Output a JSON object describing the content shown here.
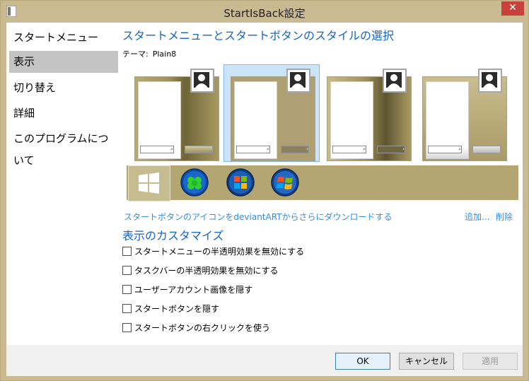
{
  "window": {
    "title": "StartIsBack設定",
    "close_label": "✕"
  },
  "sidebar": {
    "items": [
      {
        "label": "スタートメニュー"
      },
      {
        "label": "表示"
      },
      {
        "label": "切り替え"
      },
      {
        "label": "詳細"
      },
      {
        "label": "このプログラムについて"
      }
    ],
    "selected_index": 1
  },
  "main": {
    "heading": "スタートメニューとスタートボタンのスタイルの選択",
    "theme_label": "テーマ:",
    "theme_value": "Plain8",
    "styles": {
      "selected_index": 1,
      "search_glyph": "⌕",
      "arrow_glyph": "›"
    },
    "start_buttons": {
      "selected_index": 0,
      "icons": [
        "windows8-flag-icon",
        "clover-orb-icon",
        "windows-vista-orb-icon",
        "windows7-orb-icon"
      ]
    },
    "download_link": "スタートボタンのアイコンをdeviantARTからさらにダウンロードする",
    "add_link": "追加...",
    "delete_link": "削除",
    "customize_heading": "表示のカスタマイズ",
    "options": [
      {
        "label": "スタートメニューの半透明効果を無効にする",
        "checked": false
      },
      {
        "label": "タスクバーの半透明効果を無効にする",
        "checked": false
      },
      {
        "label": "ユーザーアカウント画像を隠す",
        "checked": false
      },
      {
        "label": "スタートボタンを隠す",
        "checked": false
      },
      {
        "label": "スタートボタンの右クリックを使う",
        "checked": false
      }
    ]
  },
  "buttons": {
    "ok": "OK",
    "cancel": "キャンセル",
    "apply": "適用"
  },
  "colors": {
    "accent": "#1565c0",
    "link": "#3a8bd8",
    "selection": "#cce4f7",
    "gold": "#b3a673"
  }
}
